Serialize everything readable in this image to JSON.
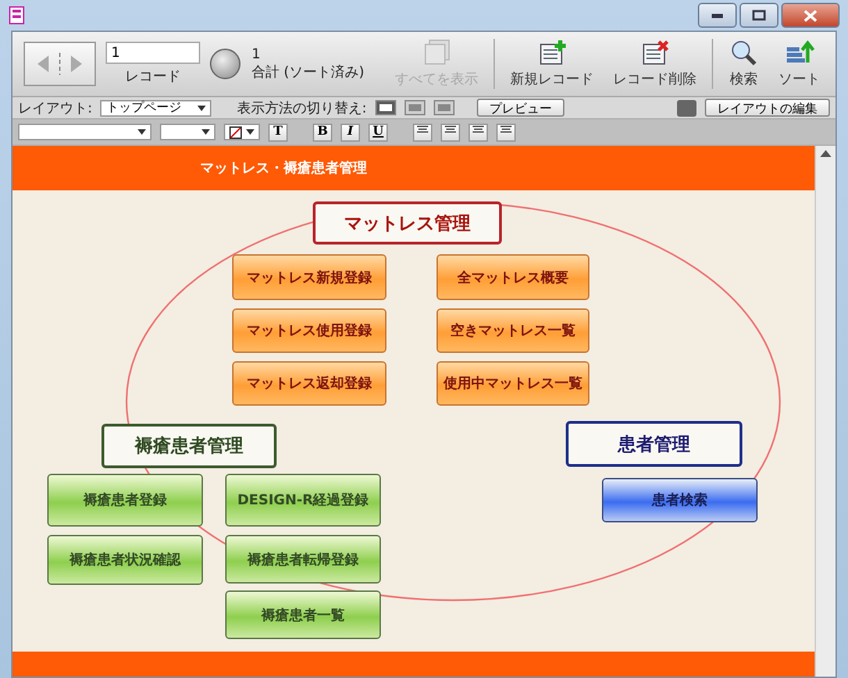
{
  "toolbar": {
    "record_value": "1",
    "record_label": "レコード",
    "found_count": "1",
    "found_label": "合計 (ソート済み)",
    "buttons": [
      {
        "kind": "show-all",
        "label": "すべてを表示",
        "disabled": true
      },
      {
        "kind": "new",
        "label": "新規レコード",
        "disabled": false
      },
      {
        "kind": "delete",
        "label": "レコード削除",
        "disabled": false
      },
      {
        "kind": "find",
        "label": "検索",
        "disabled": false
      },
      {
        "kind": "sort",
        "label": "ソート",
        "disabled": false
      }
    ]
  },
  "layout_bar": {
    "layout_label": "レイアウト:",
    "layout_value": "トップページ",
    "view_label": "表示方法の切り替え:",
    "views": [
      {
        "selected": true
      },
      {
        "selected": false
      },
      {
        "selected": false
      }
    ],
    "preview_button": "プレビュー",
    "edit_layout_button": "レイアウトの編集"
  },
  "format_bar": {
    "text_button": "T",
    "style_buttons": [
      "B",
      "I",
      "U"
    ]
  },
  "header": {
    "title": "マットレス・褥瘡患者管理"
  },
  "diagram": {
    "groups": [
      {
        "kind": "orange",
        "title": "マットレス管理",
        "buttons": [
          "マットレス新規登録",
          "マットレス使用登録",
          "マットレス返却登録",
          "全マットレス概要",
          "空きマットレス一覧",
          "使用中マットレス一覧"
        ]
      },
      {
        "kind": "green",
        "title": "褥瘡患者管理",
        "buttons": [
          "褥瘡患者登録",
          "褥瘡患者状況確認",
          "DESIGN-R経過登録",
          "褥瘡患者転帰登録",
          "褥瘡患者一覧"
        ]
      },
      {
        "kind": "blue",
        "title": "患者管理",
        "buttons": [
          "患者検索"
        ]
      }
    ]
  }
}
